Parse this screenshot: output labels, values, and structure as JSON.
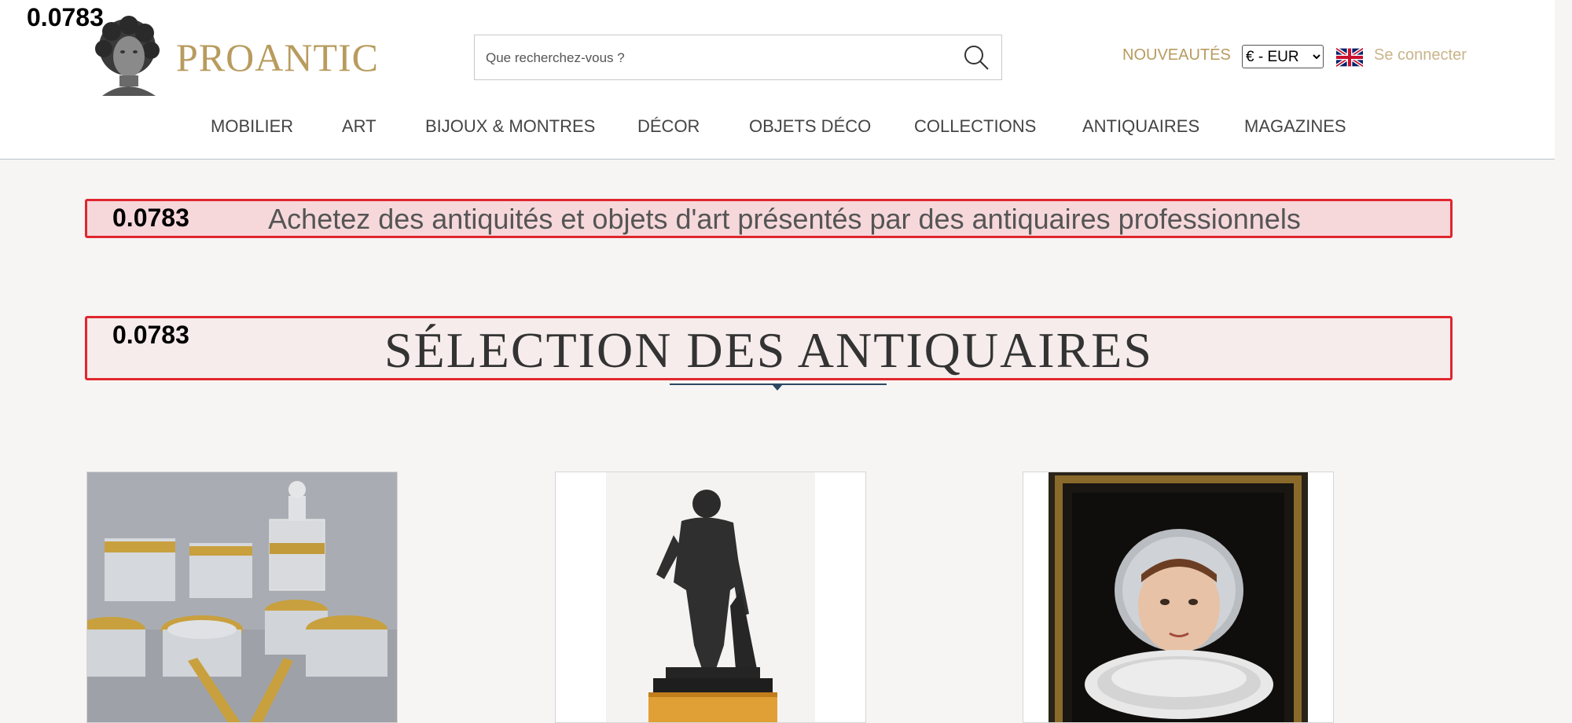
{
  "overlay": {
    "score": "0.0783"
  },
  "header": {
    "brand": "PROANTIC",
    "search": {
      "placeholder": "Que recherchez-vous ?"
    },
    "nouveautes": "NOUVEAUTÉS",
    "currency": {
      "selected": "€ - EUR"
    },
    "language_icon": "uk-flag-icon",
    "login": "Se connecter",
    "brand_color": "#b89b5e"
  },
  "nav": {
    "items": [
      "MOBILIER",
      "ART",
      "BIJOUX & MONTRES",
      "DÉCOR",
      "OBJETS DÉCO",
      "COLLECTIONS",
      "ANTIQUAIRES",
      "MAGAZINES"
    ]
  },
  "main": {
    "tagline": {
      "score": "0.0783",
      "text": "Achetez des antiquités et objets d'art présentés par des antiquaires professionnels"
    },
    "section": {
      "score": "0.0783",
      "title": "SÉLECTION DES ANTIQUAIRES"
    },
    "products": [
      {
        "image": "gilded-crystal-glassware"
      },
      {
        "image": "bronze-hercules-statue"
      },
      {
        "image": "portrait-woman-ruff-collar"
      }
    ]
  },
  "colors": {
    "highlight_border": "#e0262e",
    "accent_rule": "#2c4863"
  }
}
